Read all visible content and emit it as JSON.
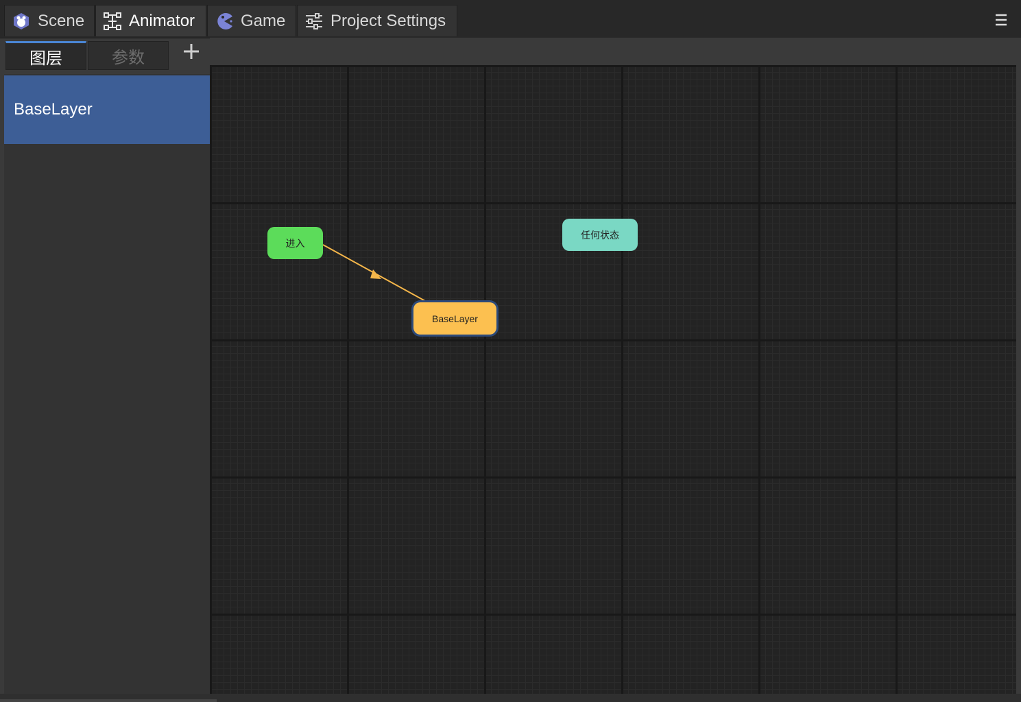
{
  "tabs": [
    {
      "label": "Scene",
      "icon": "scene-cube-icon"
    },
    {
      "label": "Animator",
      "icon": "animator-graph-icon"
    },
    {
      "label": "Game",
      "icon": "game-pacman-icon"
    },
    {
      "label": "Project Settings",
      "icon": "sliders-icon"
    }
  ],
  "active_tab": "Animator",
  "subtabs": {
    "layers": "图层",
    "params": "参数"
  },
  "layers": [
    {
      "name": "BaseLayer"
    }
  ],
  "graph": {
    "entry_label": "进入",
    "any_state_label": "任何状态",
    "state_label": "BaseLayer"
  },
  "colors": {
    "entry": "#5cdc5a",
    "any_state": "#7ad8c4",
    "state": "#fcc050",
    "transition": "#f5b64a",
    "selected_layer": "#3d5e96"
  }
}
